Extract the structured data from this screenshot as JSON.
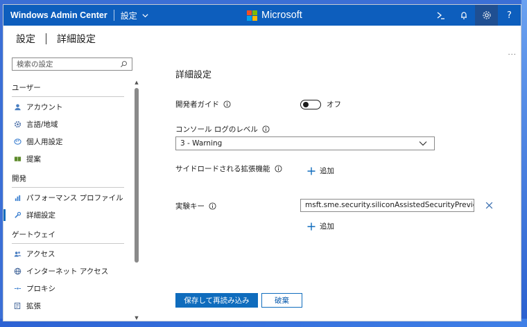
{
  "topbar": {
    "app_title": "Windows Admin Center",
    "breadcrumb": "設定",
    "brand_text": "Microsoft",
    "icons": [
      "powershell-icon",
      "bell-icon",
      "gear-icon",
      "help-icon"
    ],
    "help_glyph": "?",
    "brand_color": "#0d5ebd"
  },
  "header": {
    "section": "設定",
    "page": "詳細設定",
    "more": "..."
  },
  "search": {
    "placeholder": "検索の設定"
  },
  "sidebar": {
    "groups": [
      {
        "label": "ユーザー",
        "items": [
          {
            "label": "アカウント",
            "icon": "user-icon"
          },
          {
            "label": "言語/地域",
            "icon": "gear-icon"
          },
          {
            "label": "個人用設定",
            "icon": "palette-icon"
          },
          {
            "label": "提案",
            "icon": "book-icon"
          }
        ]
      },
      {
        "label": "開発",
        "items": [
          {
            "label": "パフォーマンス プロファイル",
            "icon": "chart-icon"
          },
          {
            "label": "詳細設定",
            "icon": "tool-icon",
            "selected": true
          }
        ]
      },
      {
        "label": "ゲートウェイ",
        "items": [
          {
            "label": "アクセス",
            "icon": "users-icon"
          },
          {
            "label": "インターネット アクセス",
            "icon": "globe-icon"
          },
          {
            "label": "プロキシ",
            "icon": "proxy-icon"
          },
          {
            "label": "拡張",
            "icon": "extension-icon"
          }
        ]
      }
    ]
  },
  "main": {
    "title": "詳細設定",
    "developer_guide": {
      "label": "開発者ガイド",
      "toggle_state": "オフ"
    },
    "console_log": {
      "label": "コンソール ログのレベル",
      "value": "3 - Warning"
    },
    "sideloaded": {
      "label": "サイドロードされる拡張機能",
      "add_label": "追加"
    },
    "experiment_keys": {
      "label": "実験キー",
      "value": "msft.sme.security.siliconAssistedSecurityPreview",
      "add_label": "追加"
    },
    "save_label": "保存して再読み込み",
    "discard_label": "破棄"
  },
  "colors": {
    "accent": "#0f6cbd"
  }
}
